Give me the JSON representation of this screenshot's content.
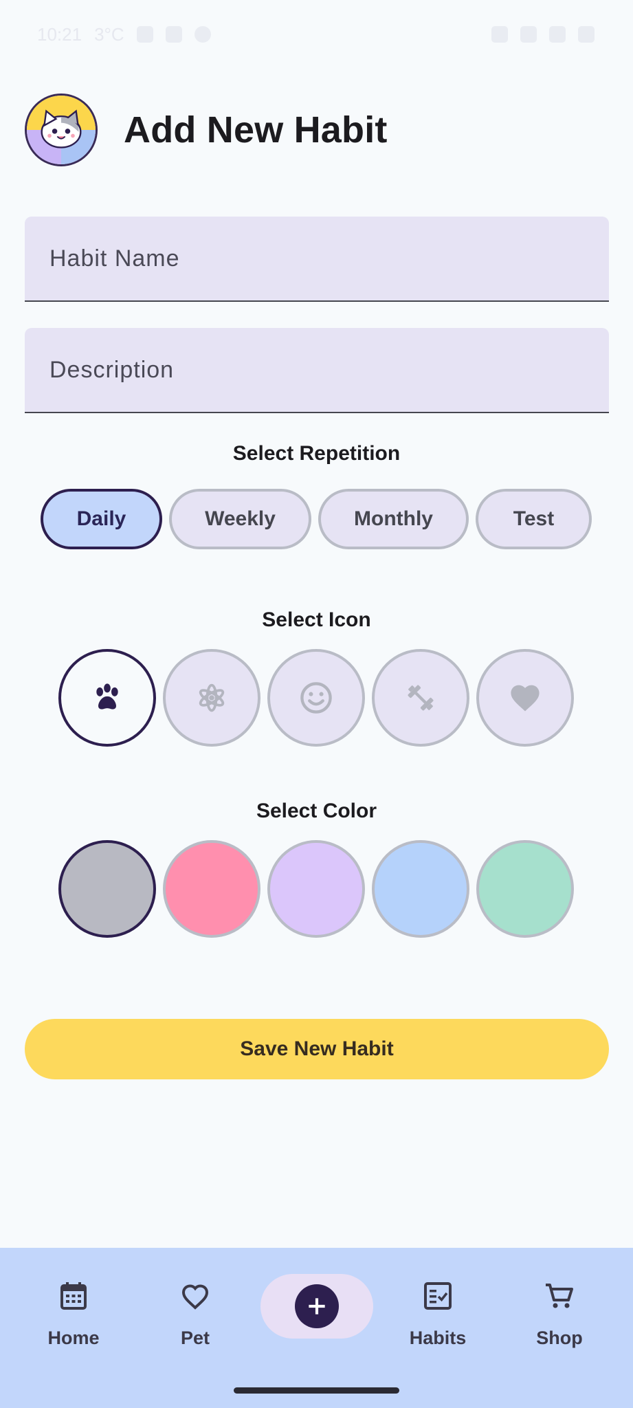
{
  "status_bar": {
    "time": "10:21",
    "extra": "3°C"
  },
  "header": {
    "title": "Add New Habit"
  },
  "form": {
    "name_placeholder": "Habit Name",
    "description_placeholder": "Description"
  },
  "repetition": {
    "label": "Select Repetition",
    "options": [
      "Daily",
      "Weekly",
      "Monthly",
      "Test"
    ],
    "selected": "Daily"
  },
  "icons": {
    "label": "Select Icon",
    "options": [
      "paw-icon",
      "flower-icon",
      "smiley-icon",
      "dumbbell-icon",
      "heart-icon"
    ],
    "selected": "paw-icon"
  },
  "colors": {
    "label": "Select Color",
    "options": [
      "#b8b9c2",
      "#ff8fae",
      "#dbc6fb",
      "#b5d2fb",
      "#a6e0cd"
    ],
    "selected": "#b8b9c2"
  },
  "save_button": {
    "label": "Save New Habit",
    "color": "#fdd95c"
  },
  "nav": {
    "items": [
      {
        "label": "Home",
        "icon": "calendar-icon"
      },
      {
        "label": "Pet",
        "icon": "heart-outline-icon"
      },
      {
        "label": "",
        "icon": "add-icon"
      },
      {
        "label": "Habits",
        "icon": "checklist-icon"
      },
      {
        "label": "Shop",
        "icon": "cart-icon"
      }
    ]
  },
  "theme": {
    "accent": "#2d1f4f",
    "nav_bg": "#c2d6fb",
    "field_bg": "#e6e3f4"
  }
}
